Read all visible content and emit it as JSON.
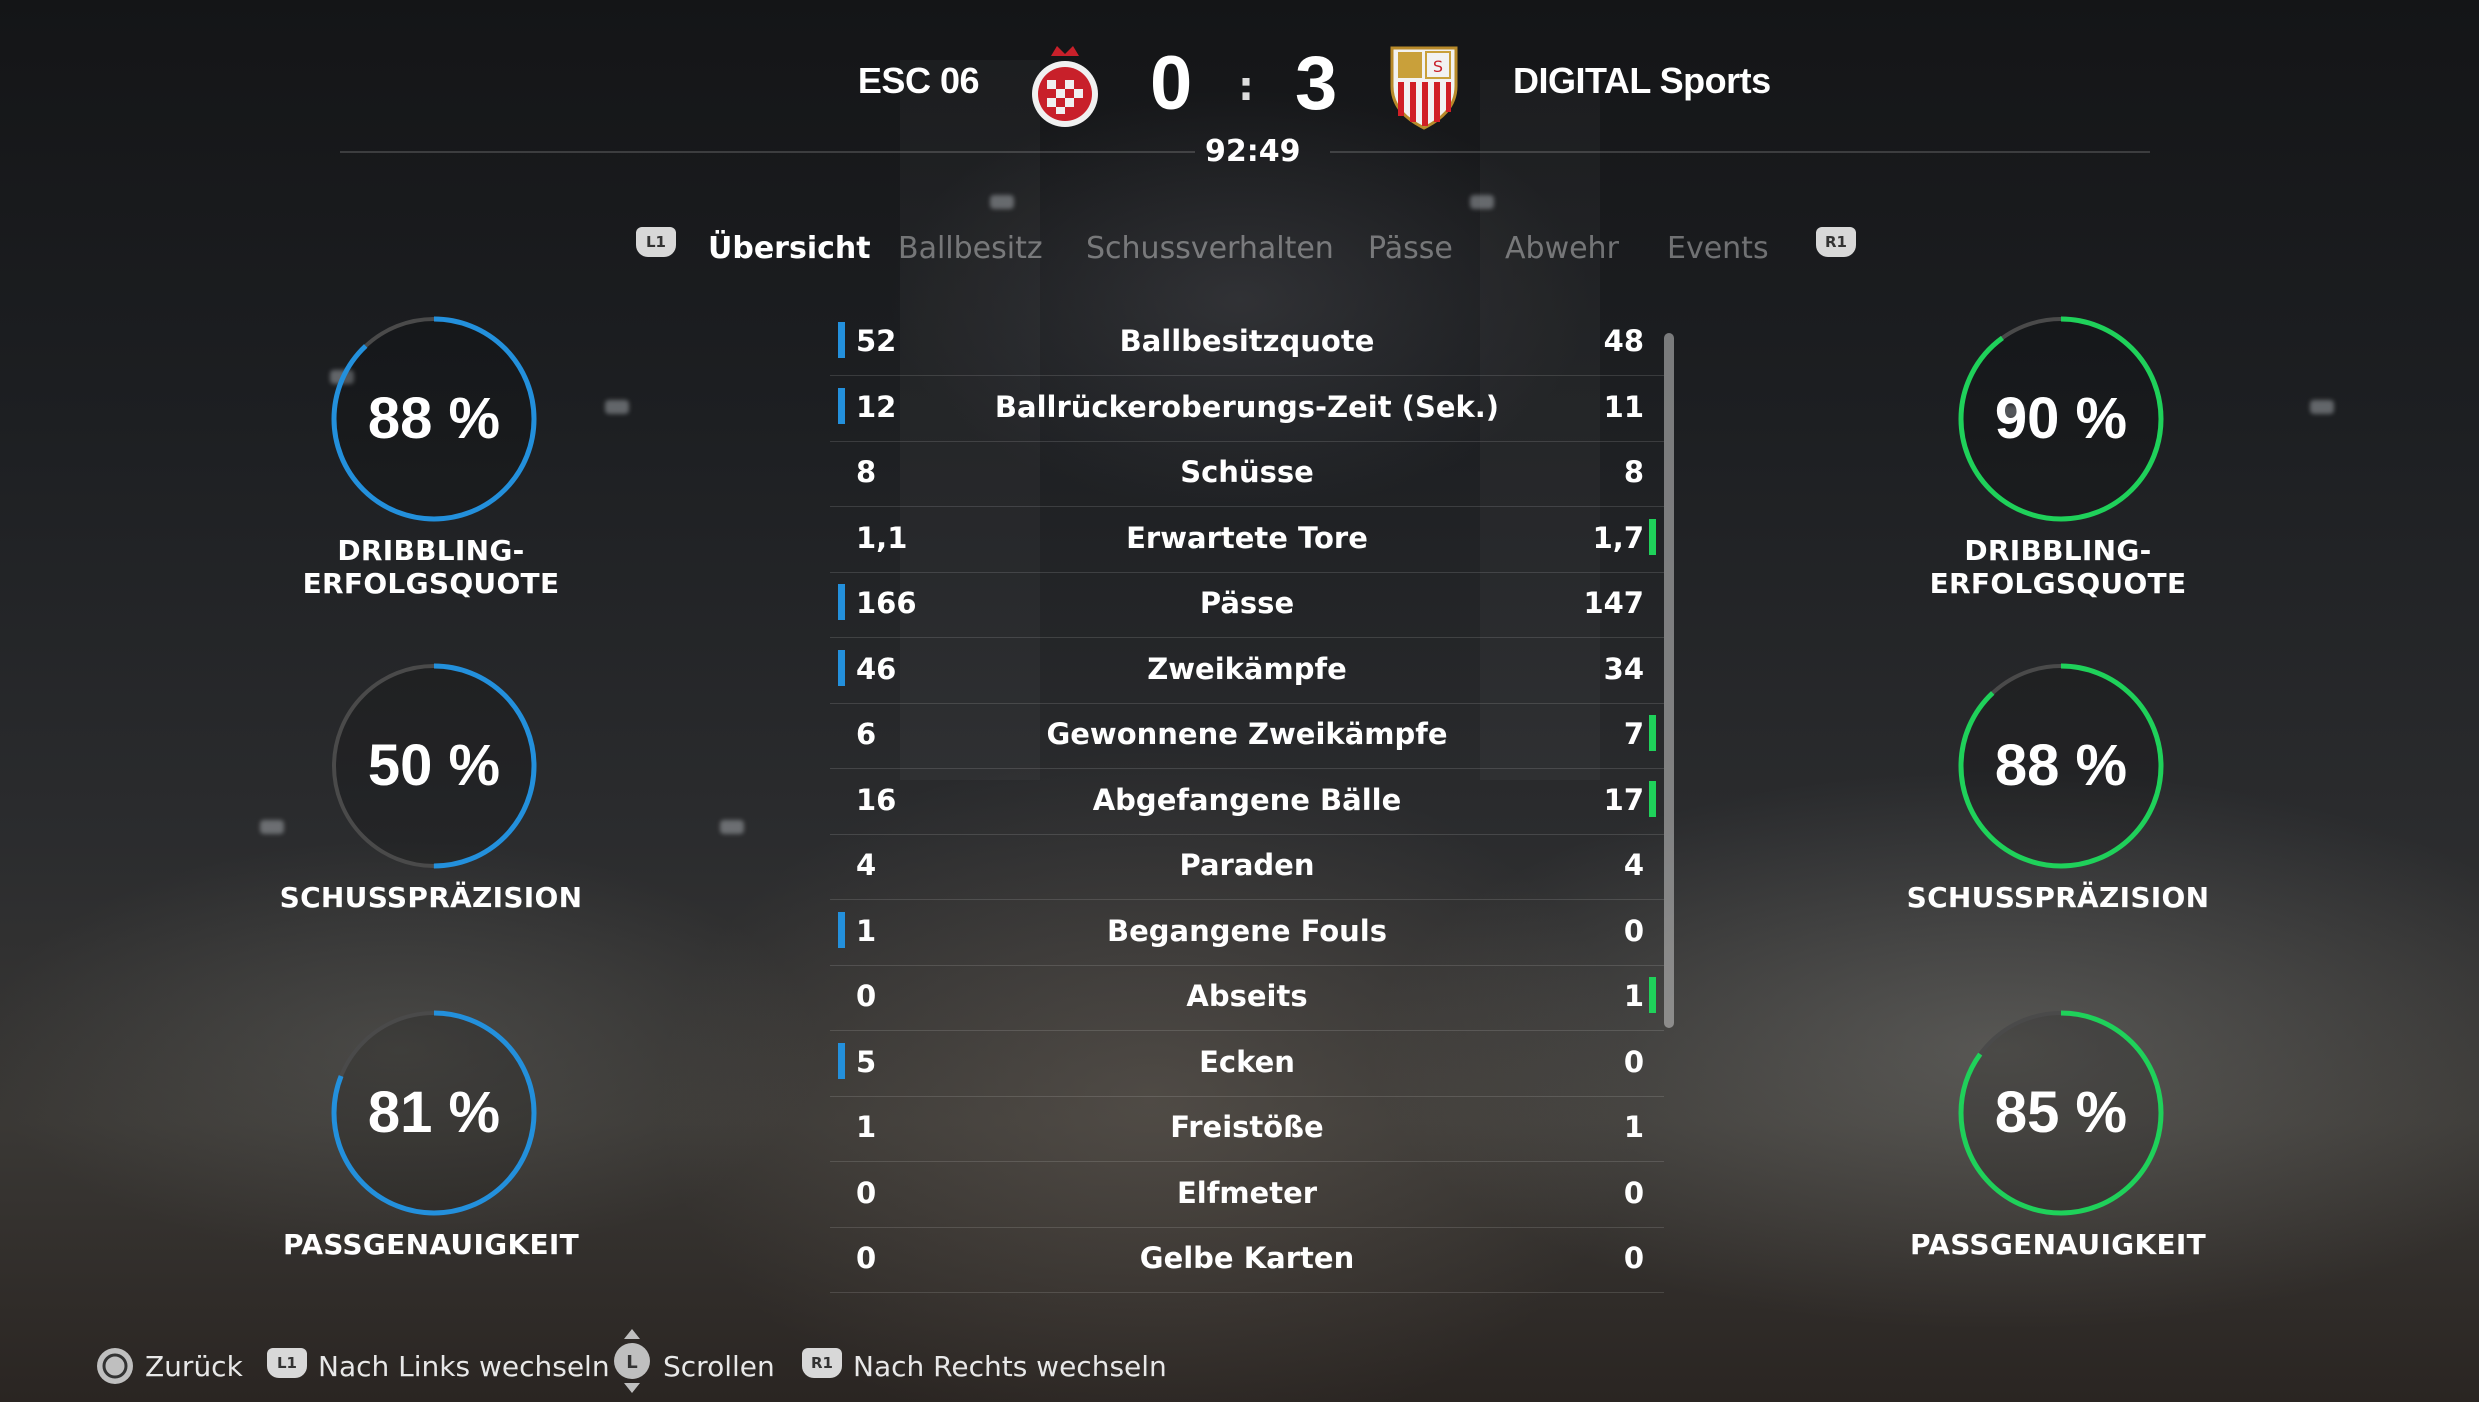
{
  "header": {
    "home_team": "ESC 06",
    "away_team": "DIGITAL Sports",
    "home_score": "0",
    "away_score": "3",
    "separator": ":",
    "clock": "92:49",
    "home_crest": "home-club-crest",
    "away_crest": "away-club-crest"
  },
  "tabs": {
    "left_button": "L1",
    "right_button": "R1",
    "items": [
      {
        "label": "Übersicht",
        "active": true
      },
      {
        "label": "Ballbesitz",
        "active": false
      },
      {
        "label": "Schussverhalten",
        "active": false
      },
      {
        "label": "Pässe",
        "active": false
      },
      {
        "label": "Abwehr",
        "active": false
      },
      {
        "label": "Events",
        "active": false
      }
    ]
  },
  "colors": {
    "home_accent": "#2390dc",
    "away_accent": "#1fd15a",
    "track": "#4a4a4a"
  },
  "home_gauges": [
    {
      "value": "88 %",
      "fraction": 0.88,
      "label": "DRIBBLING-ERFOLGSQUOTE"
    },
    {
      "value": "50 %",
      "fraction": 0.5,
      "label": "SCHUSSPRÄZISION"
    },
    {
      "value": "81 %",
      "fraction": 0.81,
      "label": "PASSGENAUIGKEIT"
    }
  ],
  "away_gauges": [
    {
      "value": "90 %",
      "fraction": 0.9,
      "label": "DRIBBLING-ERFOLGSQUOTE"
    },
    {
      "value": "88 %",
      "fraction": 0.88,
      "label": "SCHUSSPRÄZISION"
    },
    {
      "value": "85 %",
      "fraction": 0.85,
      "label": "PASSGENAUIGKEIT"
    }
  ],
  "stats": [
    {
      "name": "Ballbesitzquote",
      "home": "52",
      "away": "48",
      "leader": "home"
    },
    {
      "name": "Ballrückeroberungs-Zeit (Sek.)",
      "home": "12",
      "away": "11",
      "leader": "home"
    },
    {
      "name": "Schüsse",
      "home": "8",
      "away": "8",
      "leader": "none"
    },
    {
      "name": "Erwartete Tore",
      "home": "1,1",
      "away": "1,7",
      "leader": "away"
    },
    {
      "name": "Pässe",
      "home": "166",
      "away": "147",
      "leader": "home"
    },
    {
      "name": "Zweikämpfe",
      "home": "46",
      "away": "34",
      "leader": "home"
    },
    {
      "name": "Gewonnene Zweikämpfe",
      "home": "6",
      "away": "7",
      "leader": "away"
    },
    {
      "name": "Abgefangene Bälle",
      "home": "16",
      "away": "17",
      "leader": "away"
    },
    {
      "name": "Paraden",
      "home": "4",
      "away": "4",
      "leader": "none"
    },
    {
      "name": "Begangene Fouls",
      "home": "1",
      "away": "0",
      "leader": "home"
    },
    {
      "name": "Abseits",
      "home": "0",
      "away": "1",
      "leader": "away"
    },
    {
      "name": "Ecken",
      "home": "5",
      "away": "0",
      "leader": "home"
    },
    {
      "name": "Freistöße",
      "home": "1",
      "away": "1",
      "leader": "none"
    },
    {
      "name": "Elfmeter",
      "home": "0",
      "away": "0",
      "leader": "none"
    },
    {
      "name": "Gelbe Karten",
      "home": "0",
      "away": "0",
      "leader": "none"
    }
  ],
  "footer": {
    "back": {
      "icon": "circle-button-icon",
      "label": "Zurück"
    },
    "left": {
      "icon": "L1",
      "label": "Nach Links wechseln"
    },
    "scroll": {
      "icon": "L",
      "label": "Scrollen"
    },
    "right": {
      "icon": "R1",
      "label": "Nach Rechts wechseln"
    }
  }
}
